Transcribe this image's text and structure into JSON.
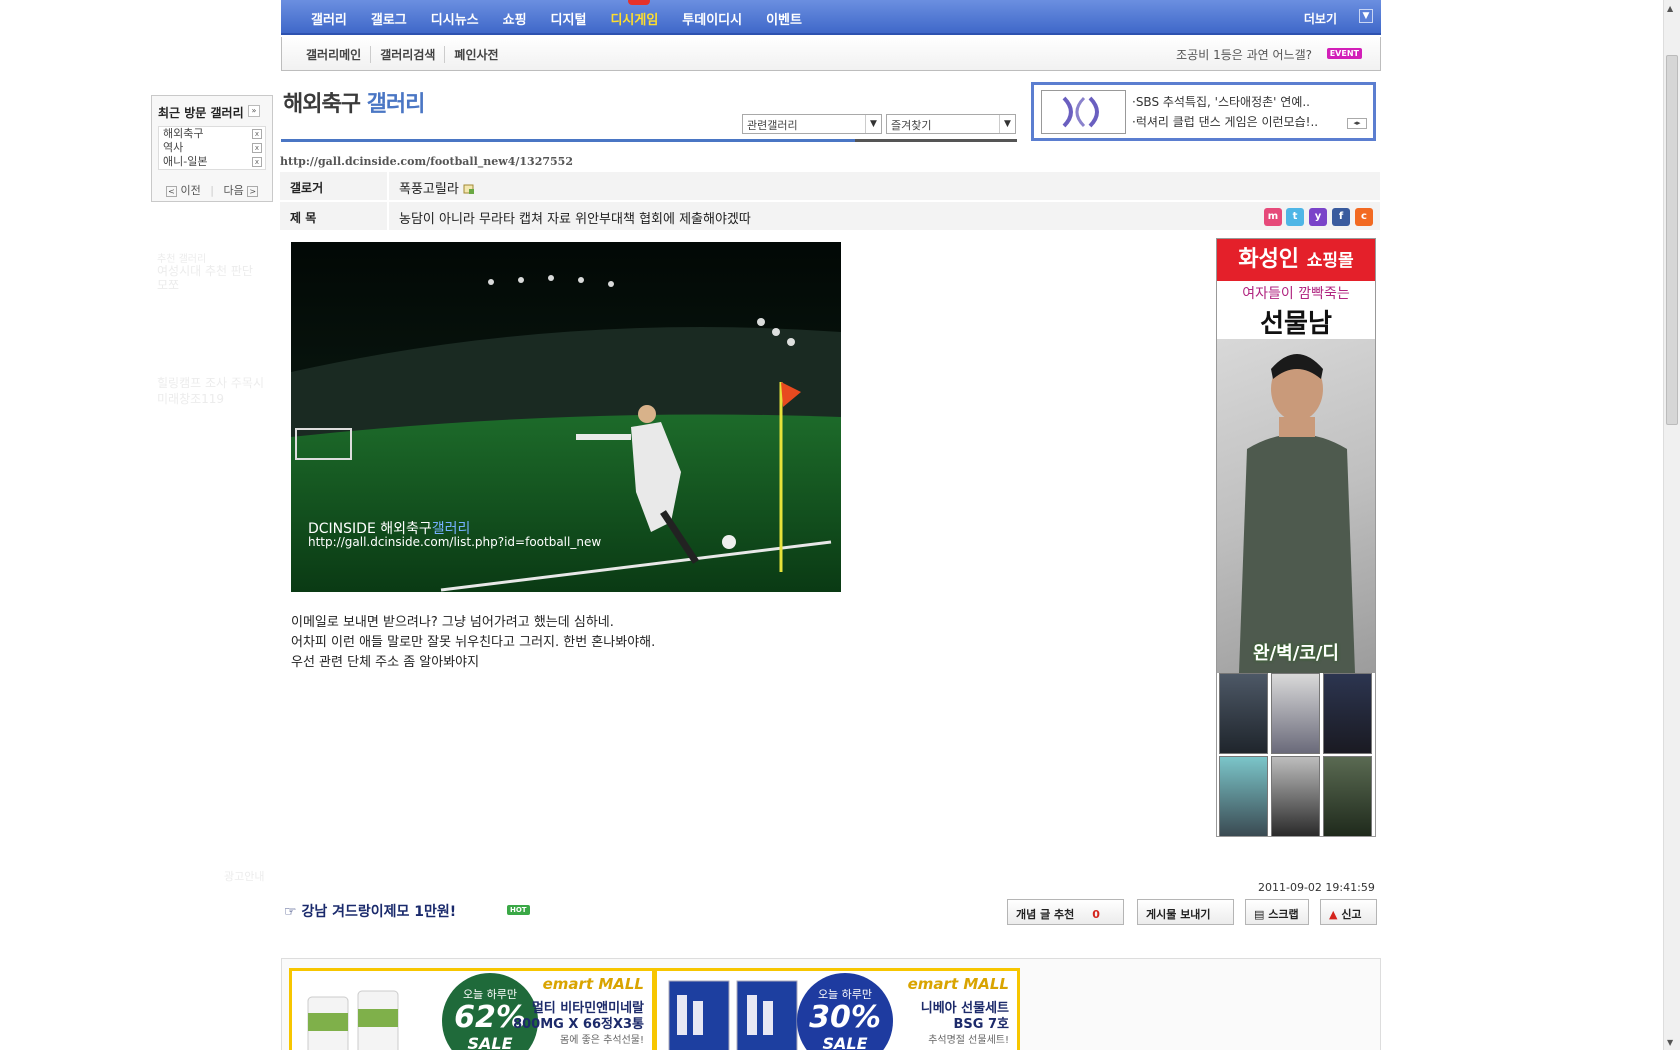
{
  "topnav": {
    "items": [
      "갤러리",
      "갤로그",
      "디시뉴스",
      "쇼핑",
      "디지털",
      "디시게임",
      "투데이디시",
      "이벤트"
    ],
    "more_label": "더보기"
  },
  "subnav": {
    "items": [
      "갤러리메인",
      "갤러리검색",
      "폐인사전"
    ],
    "event_text": "조공비 1등은 과연 어느갤?",
    "event_badge": "EVENT"
  },
  "recent": {
    "title": "최근 방문 갤러리",
    "items": [
      "해외축구",
      "역사",
      "애니-일본"
    ],
    "prev_label": "이전",
    "next_label": "다음"
  },
  "faded_sidebar": [
    "추천 갤러리",
    "여성시대 추천 판단 모쪼",
    "힐링캠프 조사 주목시",
    "미래창조119"
  ],
  "faded_footer": "광고안내",
  "gallery": {
    "title_main": "해외축구",
    "title_suffix": "갤러리",
    "related_select": "관련갤러리",
    "favorites_select": "즐겨찾기"
  },
  "top_ad": {
    "line1": "·SBS 추석특집, '스타애정촌' 연예..",
    "line2": "·럭셔리 클럽 댄스 게임은 이런모습!.."
  },
  "post": {
    "url": "http://gall.dcinside.com/football_new4/1327552",
    "author_label": "갤로거",
    "author": "폭풍고릴라",
    "subject_label": "제 목",
    "subject": "농담이 아니라 무라타 캡쳐 자료 위안부대책 협회에 제출해야겠따",
    "image_caption1_a": "DCINSIDE 해외축구",
    "image_caption1_b": "갤러리",
    "image_caption2": "http://gall.dcinside.com/list.php?id=football_new",
    "body": [
      "이메일로 보내면 받으려나? 그냥 넘어가려고 했는데 심하네.",
      "어차피 이런 애들 말로만 잘못 뉘우친다고 그러지. 한번 혼나봐야해.",
      "우선 관련 단체 주소 좀 알아봐야지"
    ],
    "date": "2011-09-02 19:41:59"
  },
  "share_icons": [
    {
      "name": "me2day-icon",
      "color": "#e64a7a",
      "glyph": "m"
    },
    {
      "name": "twitter-icon",
      "color": "#4fb6e6",
      "glyph": "t"
    },
    {
      "name": "yozm-icon",
      "color": "#7a44c9",
      "glyph": "y"
    },
    {
      "name": "facebook-icon",
      "color": "#3a5b9e",
      "glyph": "f"
    },
    {
      "name": "cyworld-icon",
      "color": "#f26a22",
      "glyph": "c"
    }
  ],
  "right_ad": {
    "brand": "화성인",
    "brand_suffix": "쇼핑몰",
    "line1": "여자들이 깜빡죽는",
    "line2": "선물남",
    "tagline": "완/벽/코/디"
  },
  "actions": {
    "hot_link": "강남 겨드랑이제모 1만원!",
    "hot_badge": "HOT",
    "recommend_label": "개념 글 추천",
    "recommend_count": "0",
    "send_label": "게시물 보내기",
    "scrap_label": "스크랩",
    "report_label": "신고"
  },
  "bottom_ads": [
    {
      "logo": "emart MALL",
      "t1": "오늘 하루만",
      "pct": "62%",
      "sale": "SALE",
      "l1": "멀티 비타민앤미네랄",
      "l2": "800MG X 66정X3통",
      "small": "몸에 좋은 추석선물!",
      "color": "#1f6a3a"
    },
    {
      "logo": "emart MALL",
      "t1": "오늘 하루만",
      "pct": "30%",
      "sale": "SALE",
      "l1": "니베아 선물세트",
      "l2": "BSG 7호",
      "small": "추석명절 선물세트!",
      "color": "#1e3ba0"
    }
  ]
}
